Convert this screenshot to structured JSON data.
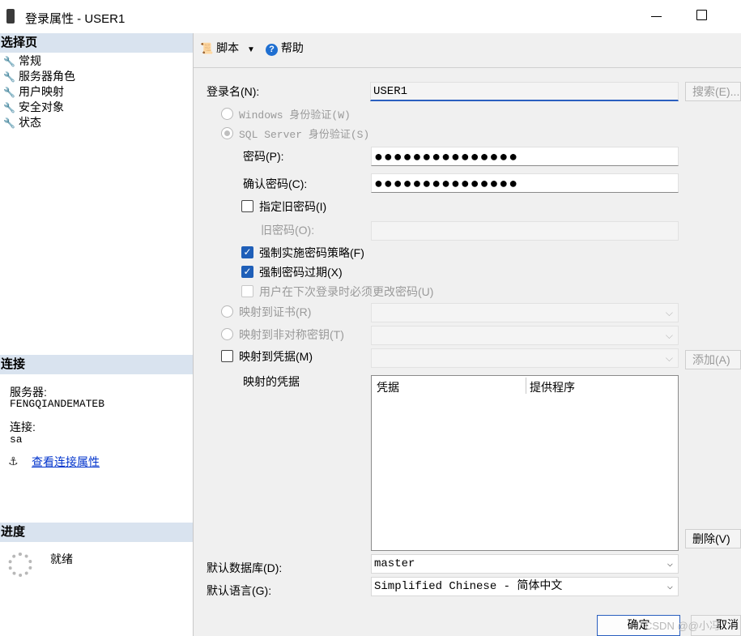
{
  "window": {
    "title": "登录属性 - USER1"
  },
  "left_panel": {
    "select_page_header": "选择页",
    "pages": [
      {
        "label": "常规",
        "icon": "wrench-icon"
      },
      {
        "label": "服务器角色",
        "icon": "wrench-icon"
      },
      {
        "label": "用户映射",
        "icon": "wrench-icon"
      },
      {
        "label": "安全对象",
        "icon": "wrench-icon"
      },
      {
        "label": "状态",
        "icon": "wrench-icon"
      }
    ],
    "connection_header": "连接",
    "server_label": "服务器:",
    "server_value": "FENGQIANDEMATEB",
    "connection_label": "连接:",
    "connection_value": "sa",
    "view_connection_link": "查看连接属性",
    "progress_header": "进度",
    "progress_status": "就绪"
  },
  "toolbar": {
    "script_label": "脚本",
    "help_label": "帮助"
  },
  "form": {
    "login_name_label": "登录名(N):",
    "login_name_value": "USER1",
    "search_button": "搜索(E)...",
    "windows_auth_label": "Windows 身份验证(W)",
    "sql_auth_label": "SQL Server 身份验证(S)",
    "password_label": "密码(P):",
    "password_value": "●●●●●●●●●●●●●●●",
    "confirm_password_label": "确认密码(C):",
    "confirm_password_value": "●●●●●●●●●●●●●●●",
    "specify_old_password_label": "指定旧密码(I)",
    "old_password_label": "旧密码(O):",
    "enforce_policy_label": "强制实施密码策略(F)",
    "enforce_expiration_label": "强制密码过期(X)",
    "must_change_label": "用户在下次登录时必须更改密码(U)",
    "map_cert_label": "映射到证书(R)",
    "map_asym_key_label": "映射到非对称密钥(T)",
    "map_credential_label": "映射到凭据(M)",
    "add_button": "添加(A)",
    "mapped_credentials_label": "映射的凭据",
    "cred_columns": [
      "凭据",
      "提供程序"
    ],
    "remove_button": "删除(V)",
    "default_db_label": "默认数据库(D):",
    "default_db_value": "master",
    "default_lang_label": "默认语言(G):",
    "default_lang_value": "Simplified Chinese - 简体中文"
  },
  "footer": {
    "ok_button": "确定",
    "cancel_button": "取消",
    "watermark": "CSDN @@小冯"
  },
  "state": {
    "windows_auth_selected": false,
    "sql_auth_selected": true,
    "specify_old_password_checked": false,
    "enforce_policy_checked": true,
    "enforce_expiration_checked": true,
    "must_change_checked": false,
    "map_credential_checked": false
  },
  "colors": {
    "section_header_bg": "#d9e3ef",
    "link": "#0033cc",
    "checkbox_checked": "#1f5fb8",
    "focus_accent": "#2a5fbf"
  }
}
